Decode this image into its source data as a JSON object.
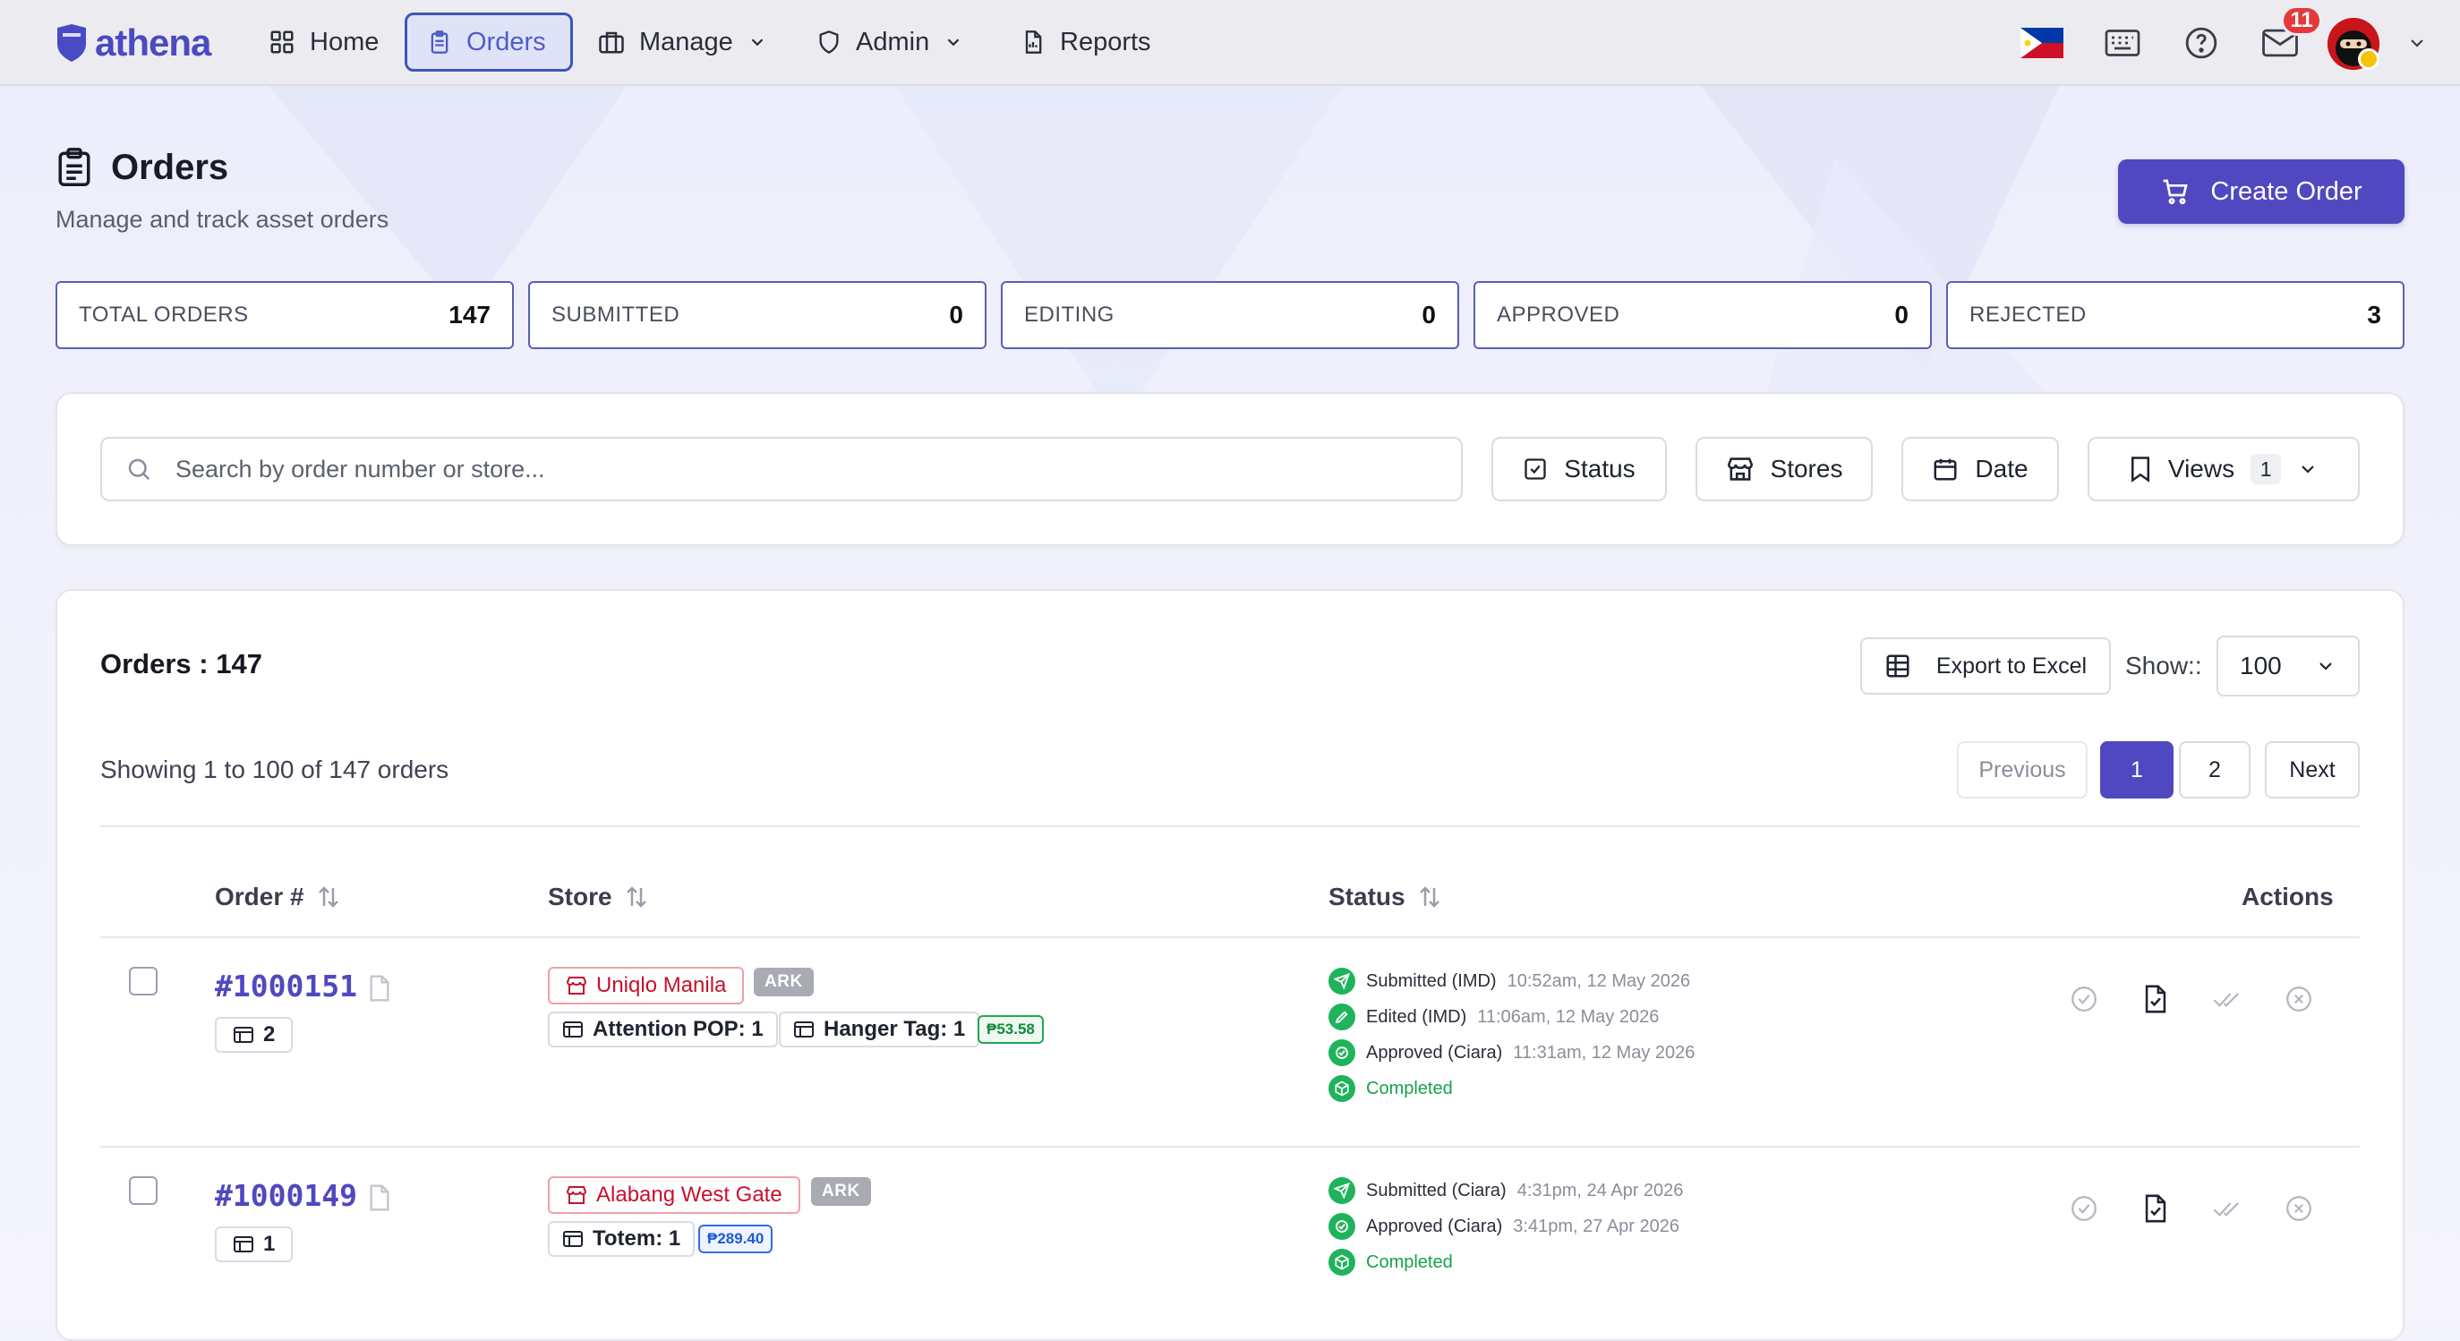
{
  "nav": {
    "logo_text": "athena",
    "items": [
      {
        "label": "Home",
        "icon": "grid-icon"
      },
      {
        "label": "Orders",
        "icon": "clipboard-icon",
        "active": true
      },
      {
        "label": "Manage",
        "icon": "briefcase-icon",
        "dropdown": true
      },
      {
        "label": "Admin",
        "icon": "shield-icon",
        "dropdown": true
      },
      {
        "label": "Reports",
        "icon": "report-icon"
      }
    ],
    "notification_count": "11",
    "accent": "#5048c1"
  },
  "header": {
    "title": "Orders",
    "subtitle": "Manage and track asset orders",
    "create_label": "Create Order"
  },
  "stats": [
    {
      "label": "TOTAL ORDERS",
      "value": "147"
    },
    {
      "label": "SUBMITTED",
      "value": "0"
    },
    {
      "label": "EDITING",
      "value": "0"
    },
    {
      "label": "APPROVED",
      "value": "0"
    },
    {
      "label": "REJECTED",
      "value": "3"
    }
  ],
  "filters": {
    "search_placeholder": "Search by order number or store...",
    "status_label": "Status",
    "stores_label": "Stores",
    "date_label": "Date",
    "views_label": "Views",
    "views_count": "1"
  },
  "orders": {
    "title": "Orders : 147",
    "export_label": "Export to Excel",
    "show_label": "Show::",
    "show_value": "100",
    "showing_text": "Showing 1 to 100 of 147 orders",
    "pagination": {
      "previous": "Previous",
      "pages": [
        "1",
        "2"
      ],
      "current": "1",
      "next": "Next"
    },
    "columns": {
      "order": "Order #",
      "store": "Store",
      "status": "Status",
      "actions": "Actions"
    },
    "rows": [
      {
        "order_no": "#1000151",
        "qty": "2",
        "store": "Uniqlo Manila",
        "store_tag": "ARK",
        "items": [
          "Attention POP: 1",
          "Hanger Tag: 1"
        ],
        "price": "₱53.58",
        "statuses": [
          {
            "label": "Submitted (IMD)",
            "time": "10:52am, 12 May 2026",
            "icon": "send-icon"
          },
          {
            "label": "Edited (IMD)",
            "time": "11:06am, 12 May 2026",
            "icon": "pencil-icon"
          },
          {
            "label": "Approved (Ciara)",
            "time": "11:31am, 12 May 2026",
            "icon": "check-icon"
          },
          {
            "label": "Completed",
            "time": "",
            "icon": "box-icon"
          }
        ]
      },
      {
        "order_no": "#1000149",
        "qty": "1",
        "store": "Alabang West Gate",
        "store_tag": "ARK",
        "items": [
          "Totem: 1"
        ],
        "price": "₱289.40",
        "statuses": [
          {
            "label": "Submitted (Ciara)",
            "time": "4:31pm, 24 Apr 2026",
            "icon": "send-icon"
          },
          {
            "label": "Approved (Ciara)",
            "time": "3:41pm, 27 Apr 2026",
            "icon": "check-icon"
          },
          {
            "label": "Completed",
            "time": "",
            "icon": "box-icon"
          }
        ]
      }
    ]
  }
}
